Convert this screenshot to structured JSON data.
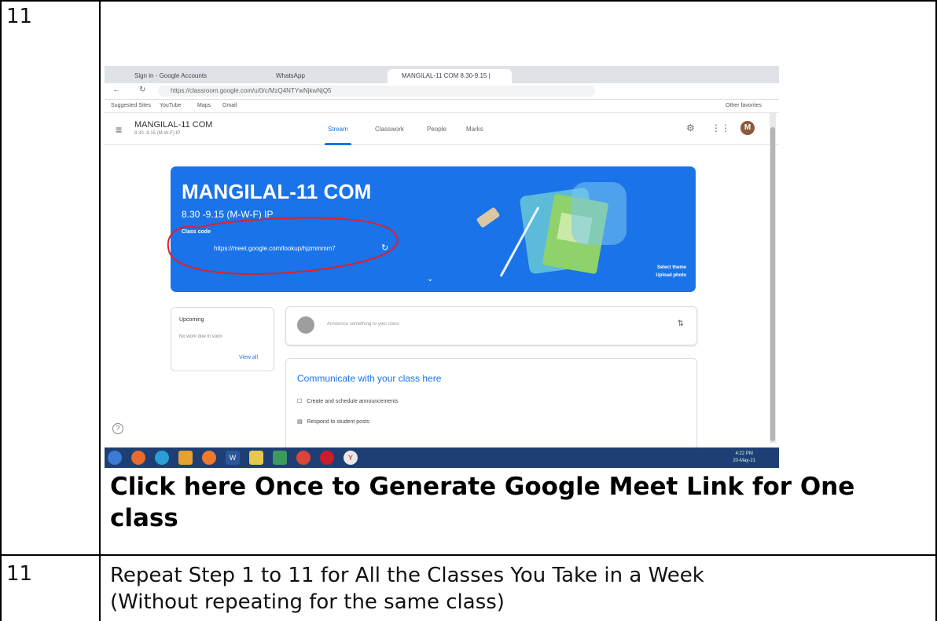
{
  "table": {
    "row1_step": "11",
    "row1_caption": "Click here Once to Generate Google Meet Link for One class",
    "row2_step": "11",
    "row2_text_line1": "Repeat Step 1 to 11 for All the Classes You Take in a Week",
    "row2_text_line2": "(Without repeating for the same class)"
  },
  "screenshot": {
    "tabs": [
      "Sign in - Google Accounts",
      "WhatsApp",
      "MANGILAL-11 COM 8.30-9.15 |"
    ],
    "url": "https://classroom.google.com/u/0/c/MzQ4NTYwNjkwNjQ5",
    "bookmarks": [
      "Suggested Sites",
      "YouTube",
      "Maps",
      "Gmail",
      "Other favorites"
    ],
    "class_name": "MANGILAL-11 COM",
    "class_sub": "8.30 -9.15 (M-W-F) IP",
    "nav_tabs": [
      "Stream",
      "Classwork",
      "People",
      "Marks"
    ],
    "avatar_letter": "M",
    "banner": {
      "title": "MANGILAL-11 COM",
      "subtitle": "8.30 -9.15 (M-W-F) IP",
      "code_label": "Class code",
      "meet_link": "https://meet.google.com/lookup/hjzmmmm7",
      "select_theme": "Select theme",
      "upload_photo": "Upload photo"
    },
    "upcoming": {
      "title": "Upcoming",
      "empty": "No work due in soon",
      "view_all": "View all"
    },
    "announce_placeholder": "Announce something to your class",
    "communicate": {
      "title": "Communicate with your class here",
      "item1": "Create and schedule announcements",
      "item2": "Respond to student posts"
    },
    "help_icon": "?",
    "taskbar_time": "4:22 PM",
    "taskbar_date": "20-May-21"
  },
  "colors": {
    "banner": "#1a73e8",
    "accent": "#1a73e8",
    "annotation": "#e0202a",
    "taskbar": "#1e3f73"
  }
}
